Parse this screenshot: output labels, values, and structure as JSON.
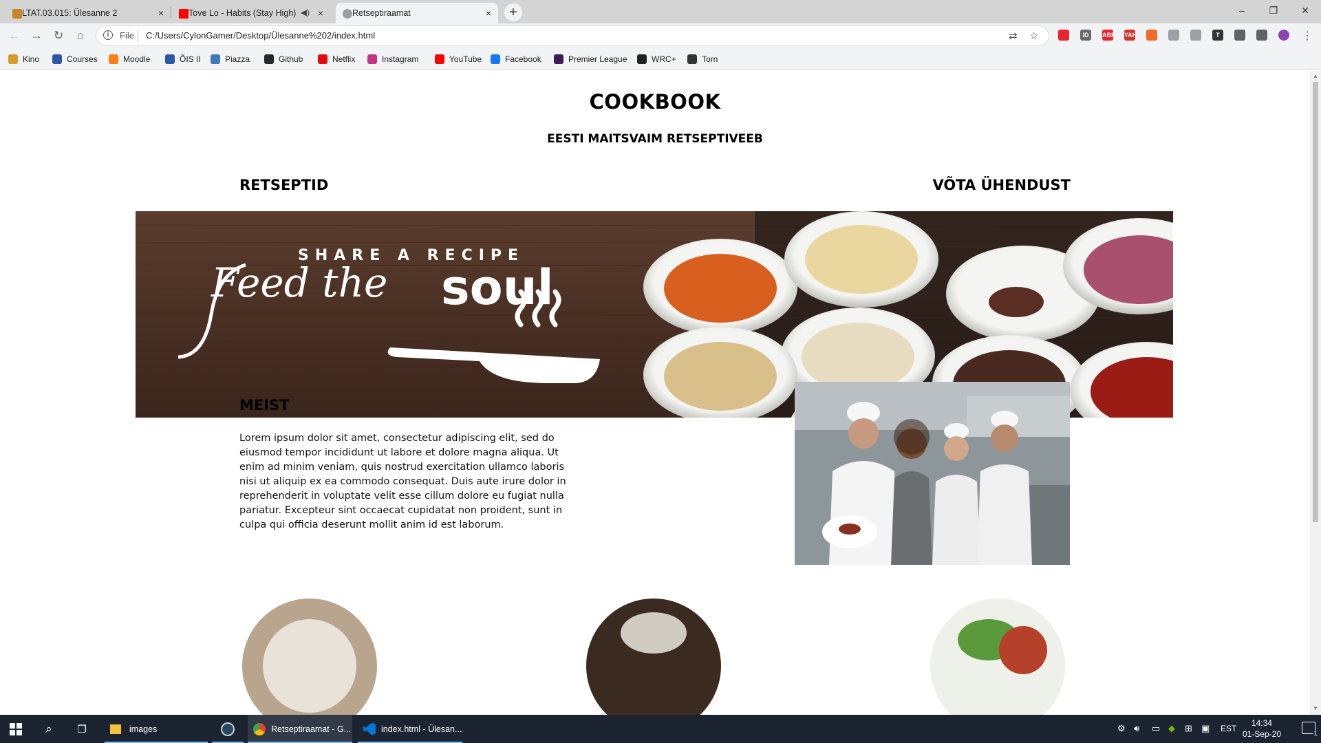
{
  "browser": {
    "tabs": [
      {
        "title": "LTAT.03.015: Ülesanne 2",
        "favicon_color": "#c8842a"
      },
      {
        "title": "Tove Lo - Habits (Stay High)",
        "favicon_color": "#ff0000"
      },
      {
        "title": "Retseptiraamat",
        "favicon_color": "#9e9e9e"
      }
    ],
    "active_tab_index": 2,
    "close_glyph": "×",
    "new_tab_glyph": "+",
    "window_controls": {
      "minimize": "–",
      "restore": "❐",
      "close": "✕"
    },
    "address": {
      "scheme": "File",
      "url": "C:/Users/CylonGamer/Desktop/Ülesanne%202/index.html"
    },
    "extensions": [
      {
        "label": "",
        "color": "#e8242f"
      },
      {
        "label": "ID",
        "color": "#6a6a6a"
      },
      {
        "label": "ABP",
        "color": "#e8242f"
      },
      {
        "label": "YAH",
        "color": "#d9322c"
      },
      {
        "label": "",
        "color": "#f26a2a"
      },
      {
        "label": "",
        "color": "#9aa0a6"
      },
      {
        "label": "",
        "color": "#9aa0a6"
      },
      {
        "label": "T",
        "color": "#333333"
      },
      {
        "label": "",
        "color": "#5f6368"
      },
      {
        "label": "",
        "color": "#5f6368"
      },
      {
        "label": "",
        "color": "#8e44ad"
      }
    ],
    "bookmarks": [
      {
        "label": "Kino",
        "color": "#d99a2b"
      },
      {
        "label": "Courses",
        "color": "#2b57a6"
      },
      {
        "label": "Moodle",
        "color": "#f98012"
      },
      {
        "label": "ÕIS II",
        "color": "#2b57a6"
      },
      {
        "label": "Piazza",
        "color": "#3e7bb6"
      },
      {
        "label": "Github",
        "color": "#24292e"
      },
      {
        "label": "Netflix",
        "color": "#e50914"
      },
      {
        "label": "Instagram",
        "color": "#c13584"
      },
      {
        "label": "YouTube",
        "color": "#ff0000"
      },
      {
        "label": "Facebook",
        "color": "#1877f2"
      },
      {
        "label": "Premier League",
        "color": "#3d195b"
      },
      {
        "label": "WRC+",
        "color": "#222222"
      },
      {
        "label": "Torn",
        "color": "#333333"
      }
    ]
  },
  "page": {
    "title": "COOKBOOK",
    "subtitle": "EESTI MAITSVAIM RETSEPTIVEEB",
    "nav": {
      "left": "RETSEPTID",
      "right": "VÕTA ÜHENDUST"
    },
    "banner": {
      "small_text": "SHARE A RECIPE",
      "script_text": "Feed the",
      "big_text": "soul"
    },
    "about": {
      "heading": "MEIST",
      "body": "Lorem ipsum dolor sit amet, consectetur adipiscing elit, sed do eiusmod tempor incididunt ut labore et dolore magna aliqua. Ut enim ad minim veniam, quis nostrud exercitation ullamco laboris nisi ut aliquip ex ea commodo consequat. Duis aute irure dolor in reprehenderit in voluptate velit esse cillum dolore eu fugiat nulla pariatur. Excepteur sint occaecat cupidatat non proident, sunt in culpa qui officia deserunt mollit anim id est laborum."
    }
  },
  "taskbar": {
    "items": [
      {
        "label": "images",
        "color": "#f3c43b"
      },
      {
        "label": "",
        "color": "#1b2838"
      },
      {
        "label": "Retseptiraamat - G...",
        "color": "#4285f4"
      },
      {
        "label": "index.html - Ülesan...",
        "color": "#0078d7"
      }
    ],
    "language": "EST",
    "time": "14:34",
    "date": "01-Sep-20",
    "notification_count": "1"
  }
}
